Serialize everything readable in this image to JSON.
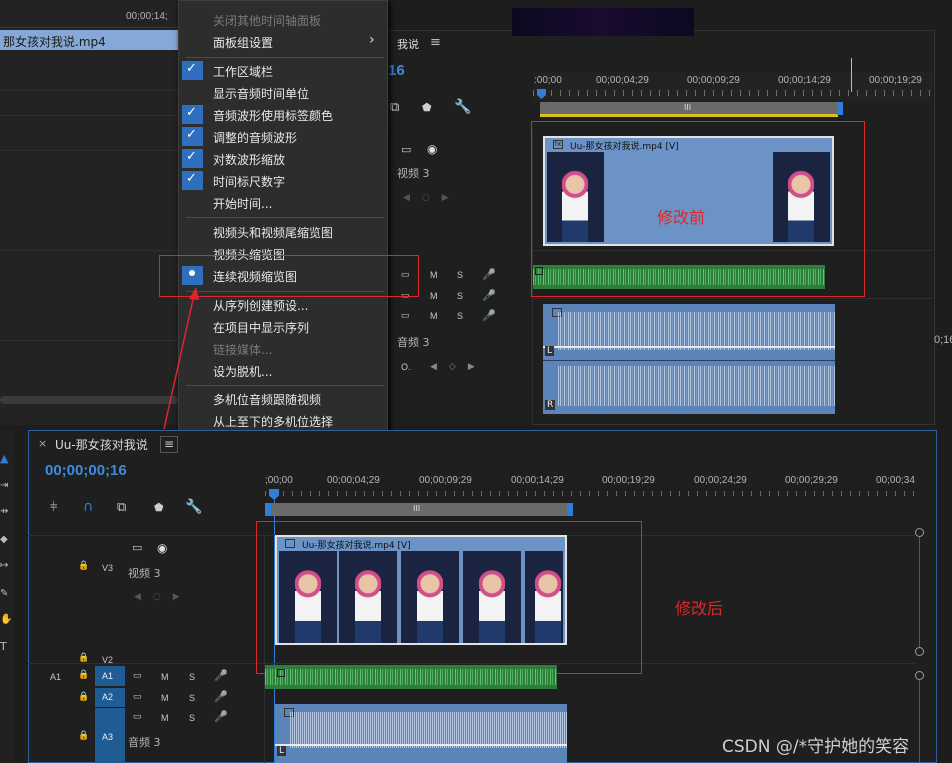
{
  "top_left_panel": {
    "clip_name": "那女孩对我说.mp4",
    "timecode": "00;00;14;"
  },
  "context_menu": {
    "items": [
      {
        "label": "关闭其他时间轴面板",
        "checked": false,
        "disabled": true
      },
      {
        "label": "面板组设置",
        "submenu": true
      },
      {
        "label": "工作区域栏",
        "checked": true
      },
      {
        "label": "显示音频时间单位",
        "checked": false
      },
      {
        "label": "音频波形使用标签颜色",
        "checked": true
      },
      {
        "label": "调整的音频波形",
        "checked": true
      },
      {
        "label": "对数波形缩放",
        "checked": true
      },
      {
        "label": "时间标尺数字",
        "checked": true
      },
      {
        "label": "开始时间...",
        "checked": false
      },
      {
        "label": "视频头和视频尾缩览图",
        "checked": false
      },
      {
        "label": "视频头缩览图",
        "checked": false
      },
      {
        "label": "连续视频缩览图",
        "selected": true
      },
      {
        "label": "从序列创建预设...",
        "checked": false
      },
      {
        "label": "在项目中显示序列",
        "checked": false
      },
      {
        "label": "链接媒体...",
        "disabled": true
      },
      {
        "label": "设为脱机...",
        "checked": false
      },
      {
        "label": "多机位音频跟随视频",
        "checked": false
      },
      {
        "label": "从上至下的多机位选择",
        "checked": false
      }
    ],
    "submenu_arrow": "›"
  },
  "upper_timeline": {
    "title": "我说",
    "menu_icon": "≡",
    "timecode_partial": "16",
    "ruler": [
      ":00;00",
      "00;00;04;29",
      "00;00;09;29",
      "00;00;14;29",
      "00;00;19;29"
    ],
    "tracks": {
      "video_label": "视频 3",
      "audio_label": "音频 3",
      "m": "M",
      "s": "S"
    },
    "clip_label": "Uu-那女孩对我说.mp4 [V]",
    "annotation": "修改前",
    "right_edge_text": "0;16",
    "ch_l": "L",
    "ch_r": "R",
    "circle_label": "O."
  },
  "lower_timeline": {
    "close": "×",
    "title": "Uu-那女孩对我说",
    "menu_icon": "≡",
    "timecode": "00;00;00;16",
    "ruler": [
      ";00;00",
      "00;00;04;29",
      "00;00;09;29",
      "00;00;14;29",
      "00;00;19;29",
      "00;00;24;29",
      "00;00;29;29",
      "00;00;34"
    ],
    "tracks": {
      "v3": "V3",
      "v2": "V2",
      "video_label": "视频 3",
      "a1_src": "A1",
      "a1": "A1",
      "a2": "A2",
      "a3": "A3",
      "audio_label": "音频 3",
      "m": "M",
      "s": "S"
    },
    "clip_label": "Uu-那女孩对我说.mp4 [V]",
    "annotation": "修改后",
    "ch_l": "L",
    "work_bar": "III"
  },
  "watermark": "CSDN @/*守护她的笑容",
  "colors": {
    "accent_blue": "#2f7fd8",
    "red_annotation": "#e0262a",
    "audio_green": "#2e7d3b",
    "audio_blue": "#5b84b8",
    "clip_blue": "#6c93c6"
  }
}
